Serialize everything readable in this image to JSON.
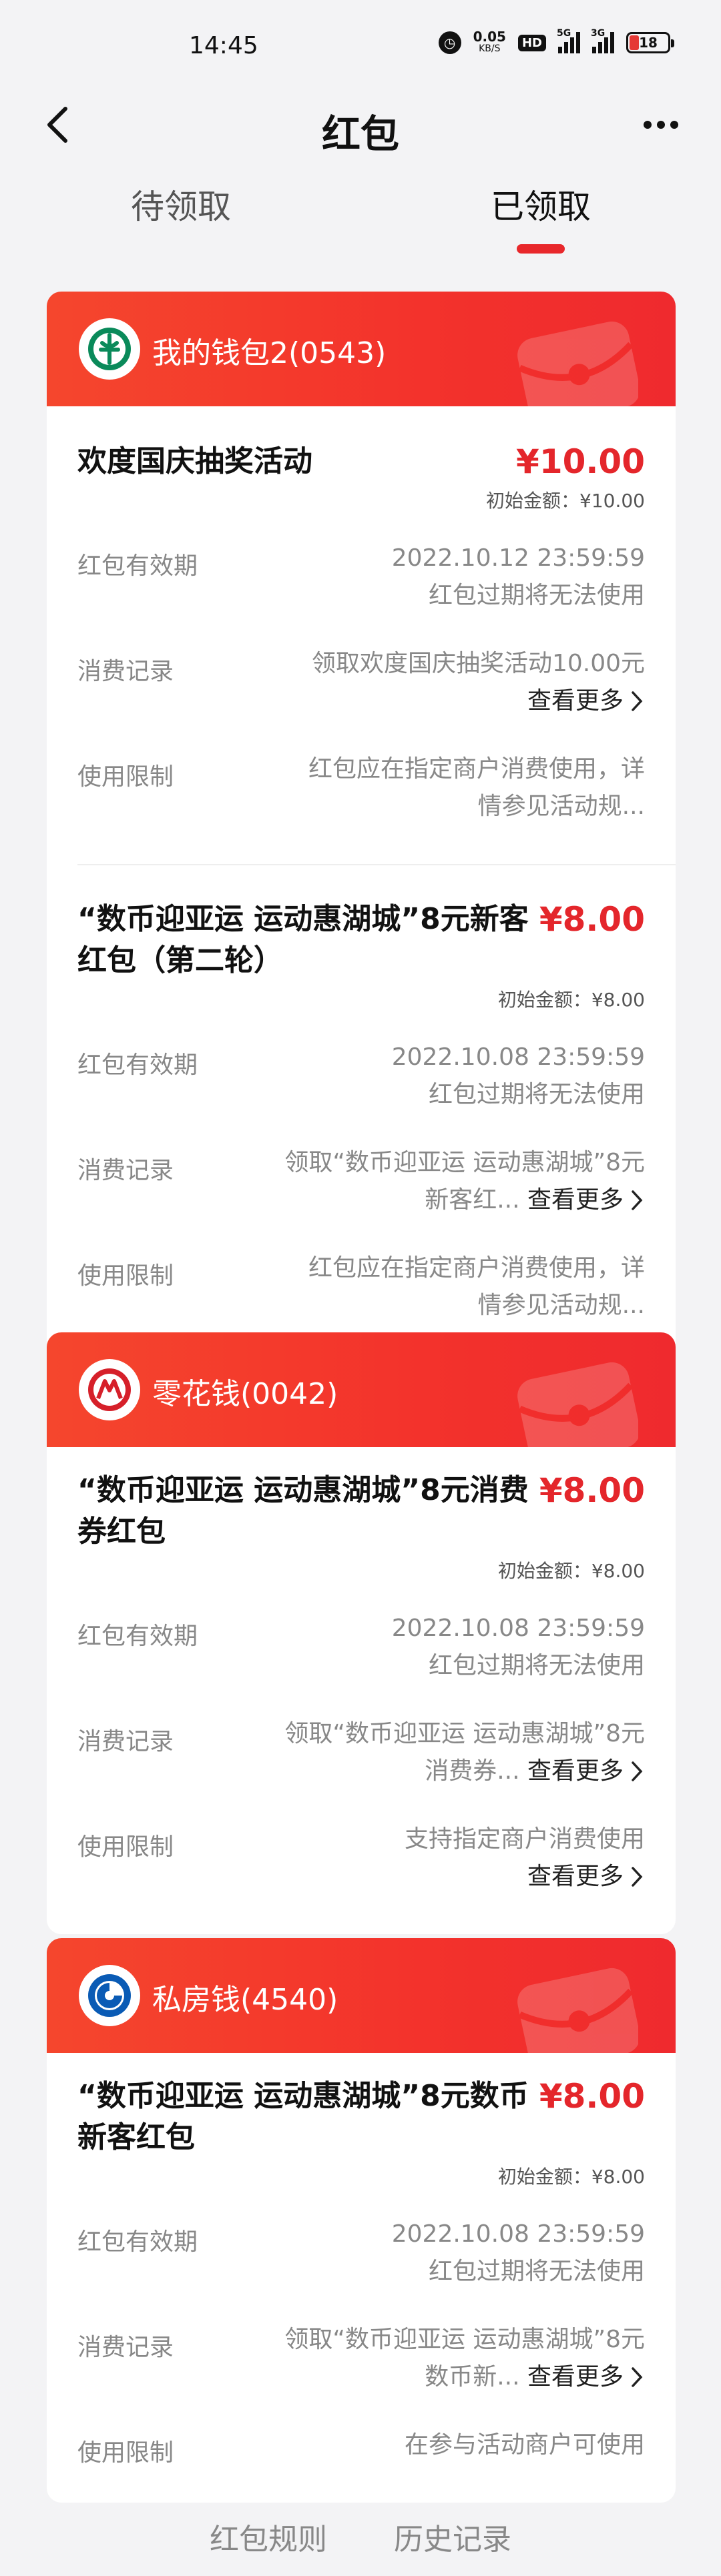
{
  "status_bar": {
    "time": "14:45",
    "net_speed": "0.05",
    "net_unit": "KB/S",
    "hd": "HD",
    "signal1_label": "5G",
    "signal2_label": "3G",
    "battery": "18",
    "battery_color": "#e53935"
  },
  "nav": {
    "title": "红包",
    "back_icon": "chevron-left-icon",
    "more_icon": "more-horizontal-icon"
  },
  "tabs": [
    {
      "label": "待领取",
      "active": false
    },
    {
      "label": "已领取",
      "active": true
    }
  ],
  "colors": {
    "accent": "#e8272b",
    "header_gradient": [
      "#f5462d",
      "#ef2a2e"
    ],
    "amount": "#e4262b"
  },
  "wallets": [
    {
      "name": "我的钱包2(0543)",
      "logo": "abc-bank-logo-icon",
      "entries": [
        {
          "title": "欢度国庆抽奖活动",
          "amount": "¥10.00",
          "initial": "初始金额：¥10.00",
          "validity_label": "红包有效期",
          "validity_date": "2022.10.12 23:59:59",
          "validity_note": "红包过期将无法使用",
          "record_label": "消费记录",
          "record_line1": "领取欢度国庆抽奖活动10.00元",
          "record_line2": "",
          "more": "查看更多",
          "limit_label": "使用限制",
          "limit_line1": "红包应在指定商户消费使用，详",
          "limit_line2": "情参见活动规...",
          "limit_more": ""
        },
        {
          "title": "“数币迎亚运 运动惠湖城”8元新客红包（第二轮）",
          "amount": "¥8.00",
          "initial": "初始金额：¥8.00",
          "validity_label": "红包有效期",
          "validity_date": "2022.10.08 23:59:59",
          "validity_note": "红包过期将无法使用",
          "record_label": "消费记录",
          "record_line1": "领取“数币迎亚运 运动惠湖城”8元",
          "record_line2": "新客红...",
          "more": "查看更多",
          "limit_label": "使用限制",
          "limit_line1": "红包应在指定商户消费使用，详",
          "limit_line2": "情参见活动规...",
          "limit_more": ""
        }
      ]
    },
    {
      "name": "零花钱(0042)",
      "logo": "cmb-bank-logo-icon",
      "entries": [
        {
          "title": "“数币迎亚运 运动惠湖城”8元消费券红包",
          "amount": "¥8.00",
          "initial": "初始金额：¥8.00",
          "validity_label": "红包有效期",
          "validity_date": "2022.10.08 23:59:59",
          "validity_note": "红包过期将无法使用",
          "record_label": "消费记录",
          "record_line1": "领取“数币迎亚运 运动惠湖城”8元",
          "record_line2": "消费券...",
          "more": "查看更多",
          "limit_label": "使用限制",
          "limit_line1": "支持指定商户消费使用",
          "limit_line2": "",
          "limit_more": "查看更多"
        }
      ]
    },
    {
      "name": "私房钱(4540)",
      "logo": "ccb-bank-logo-icon",
      "entries": [
        {
          "title": "“数币迎亚运 运动惠湖城”8元数币新客红包",
          "amount": "¥8.00",
          "initial": "初始金额：¥8.00",
          "validity_label": "红包有效期",
          "validity_date": "2022.10.08 23:59:59",
          "validity_note": "红包过期将无法使用",
          "record_label": "消费记录",
          "record_line1": "领取“数币迎亚运 运动惠湖城”8元",
          "record_line2": "数币新...",
          "more": "查看更多",
          "limit_label": "使用限制",
          "limit_line1": "在参与活动商户可使用",
          "limit_line2": "",
          "limit_more": ""
        }
      ]
    }
  ],
  "footer": {
    "rules": "红包规则",
    "history": "历史记录"
  }
}
